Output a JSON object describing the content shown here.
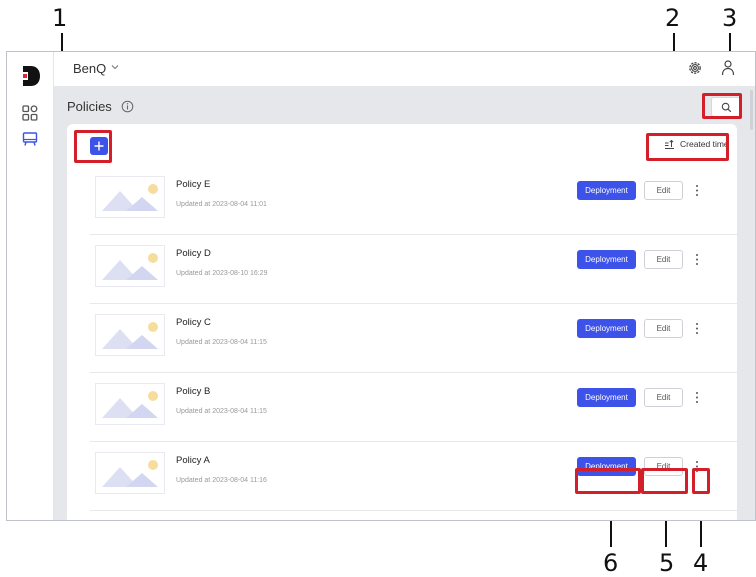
{
  "callouts": [
    "1",
    "2",
    "3",
    "4",
    "5",
    "6"
  ],
  "app": {
    "org_name": "BenQ",
    "page_title": "Policies",
    "sort_label": "Created time"
  },
  "policies": [
    {
      "name": "Policy E",
      "updated": "Updated at 2023-08-04 11:01",
      "deploy_label": "Deployment",
      "edit_label": "Edit"
    },
    {
      "name": "Policy D",
      "updated": "Updated at 2023-08-10 16:29",
      "deploy_label": "Deployment",
      "edit_label": "Edit"
    },
    {
      "name": "Policy C",
      "updated": "Updated at 2023-08-04 11:15",
      "deploy_label": "Deployment",
      "edit_label": "Edit"
    },
    {
      "name": "Policy B",
      "updated": "Updated at 2023-08-04 11:15",
      "deploy_label": "Deployment",
      "edit_label": "Edit"
    },
    {
      "name": "Policy A",
      "updated": "Updated at 2023-08-04 11:16",
      "deploy_label": "Deployment",
      "edit_label": "Edit"
    }
  ],
  "colors": {
    "accent": "#3d52e8",
    "callout_box": "#d21f2a"
  }
}
